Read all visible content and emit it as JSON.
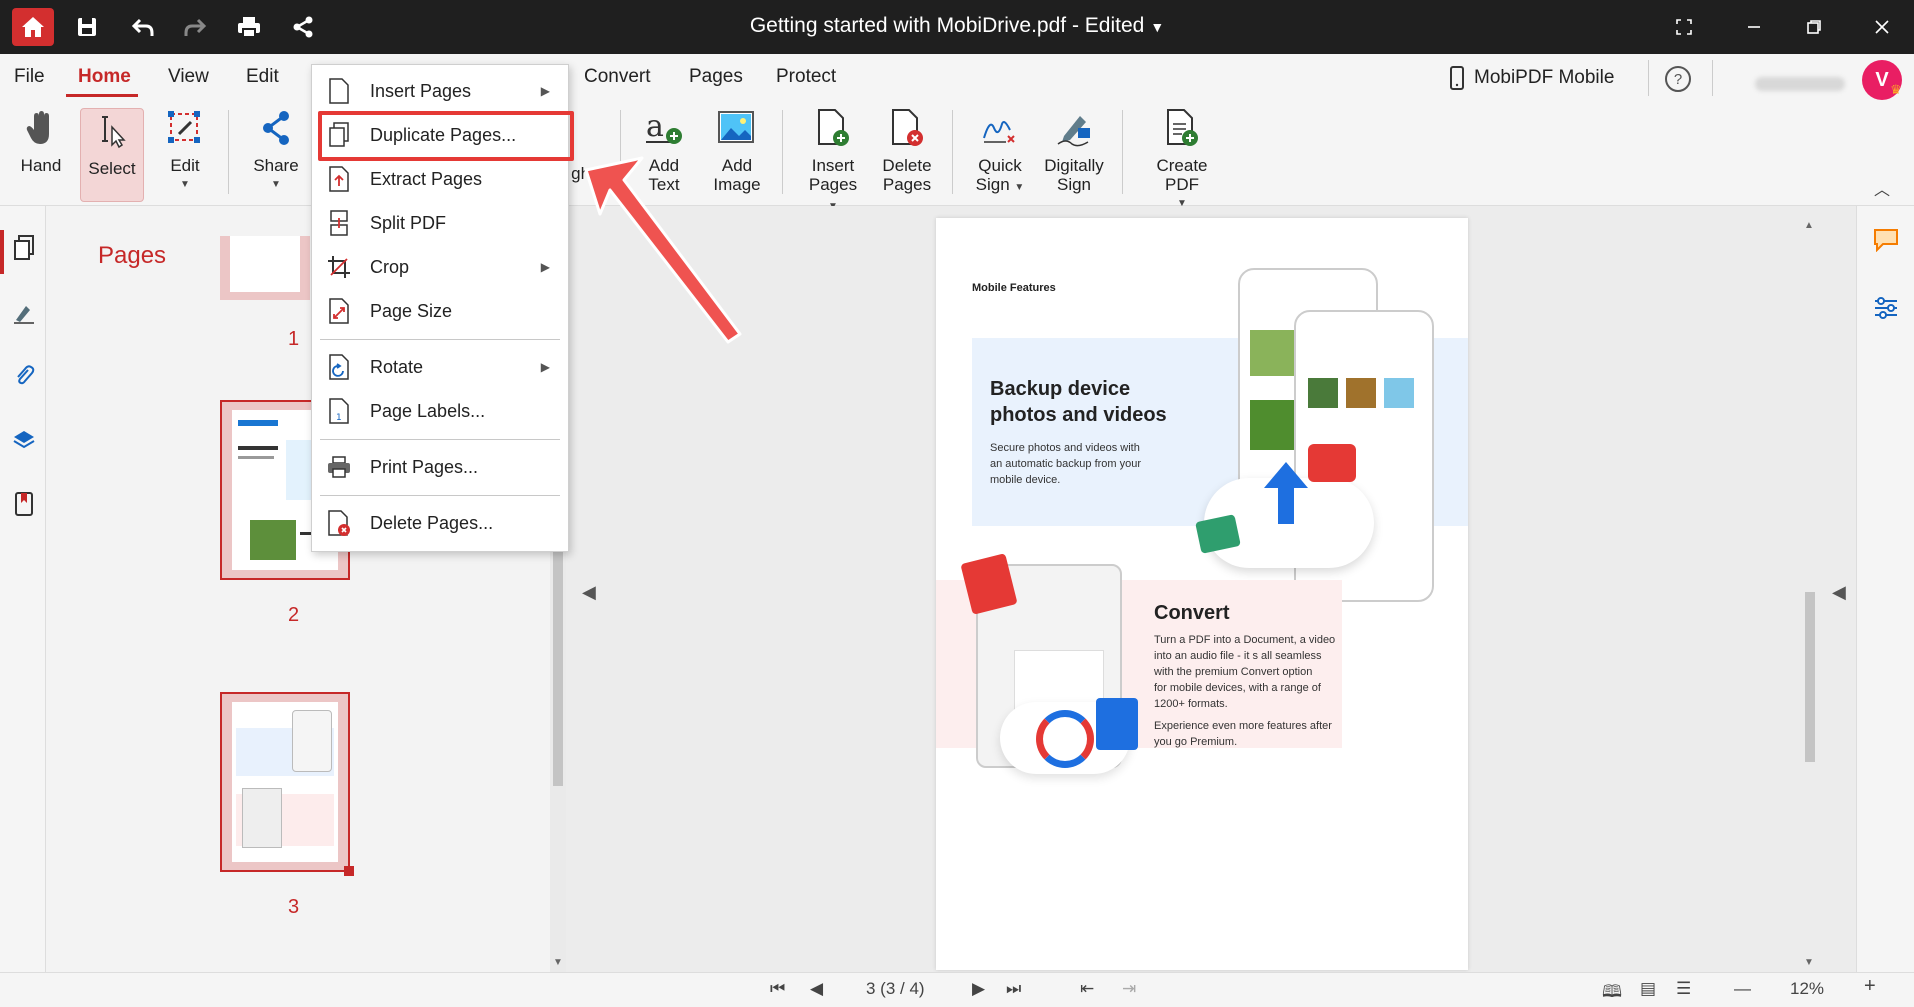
{
  "titlebar": {
    "title": "Getting started with MobiDrive.pdf - Edited",
    "icons": [
      "home-icon",
      "save-icon",
      "undo-icon",
      "redo-icon",
      "print-icon",
      "share-icon"
    ],
    "window_controls": [
      "fullscreen-icon",
      "minimize-icon",
      "restore-icon",
      "close-icon"
    ]
  },
  "menubar": {
    "items": [
      "File",
      "Home",
      "View",
      "Edit",
      "Convert",
      "Pages",
      "Protect"
    ],
    "active": "Home",
    "mobile_label": "MobiPDF Mobile",
    "avatar_letter": "V"
  },
  "ribbon": {
    "hand": "Hand",
    "select": "Select",
    "edit": "Edit",
    "share": "Share",
    "partial_label": "ght",
    "add_text_1": "Add",
    "add_text_2": "Text",
    "add_image_1": "Add",
    "add_image_2": "Image",
    "insert_pages_1": "Insert",
    "insert_pages_2": "Pages",
    "delete_pages_1": "Delete",
    "delete_pages_2": "Pages",
    "quick_sign_1": "Quick",
    "quick_sign_2": "Sign",
    "digitally_sign_1": "Digitally",
    "digitally_sign_2": "Sign",
    "create_pdf": "Create PDF"
  },
  "pages_panel": {
    "title": "Pages",
    "thumbs": [
      "1",
      "2",
      "3"
    ]
  },
  "dropdown": {
    "items": [
      {
        "label": "Insert Pages",
        "submenu": true
      },
      {
        "label": "Duplicate Pages...",
        "submenu": false
      },
      {
        "label": "Extract Pages",
        "submenu": false
      },
      {
        "label": "Split PDF",
        "submenu": false
      },
      {
        "label": "Crop",
        "submenu": true
      },
      {
        "label": "Page Size",
        "submenu": false
      },
      {
        "label": "Rotate",
        "submenu": true
      },
      {
        "label": "Page Labels...",
        "submenu": false
      },
      {
        "label": "Print Pages...",
        "submenu": false
      },
      {
        "label": "Delete Pages...",
        "submenu": false
      }
    ],
    "highlighted": "Duplicate Pages..."
  },
  "document": {
    "section_label": "Mobile Features",
    "backup_title_1": "Backup device",
    "backup_title_2": "photos and videos",
    "backup_body_1": "Secure photos and videos with",
    "backup_body_2": "an automatic backup from your",
    "backup_body_3": "mobile device.",
    "convert_title": "Convert",
    "convert_body_1": "Turn a PDF into a Document, a video",
    "convert_body_2": "into an audio file - it s all seamless",
    "convert_body_3": "with the premium Convert option",
    "convert_body_4": "for mobile devices, with a range of",
    "convert_body_5": "1200+ formats.",
    "convert_body_6": "Experience even more features after",
    "convert_body_7": "you go Premium."
  },
  "statusbar": {
    "page_indicator": "3 (3 / 4)",
    "zoom": "12%"
  },
  "colors": {
    "brand_red": "#c62828",
    "highlight_red": "#e53935",
    "titlebar_bg": "#1f1f1f"
  }
}
